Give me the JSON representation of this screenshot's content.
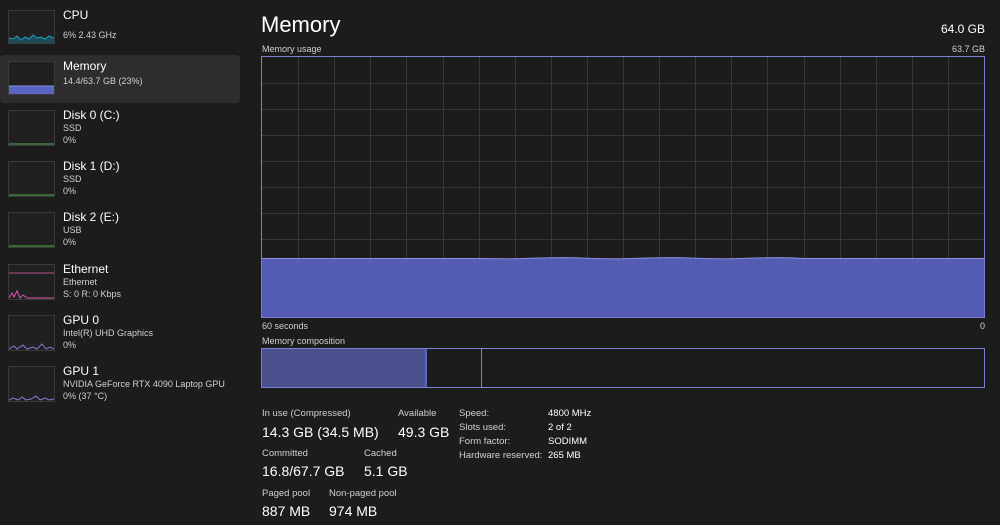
{
  "colors": {
    "background": "#1c1c1c",
    "selected": "#2d2d2d",
    "memory_accent": "#7a80d6",
    "memory_fill": "#5b63c4",
    "cpu_accent": "#1ba1c4",
    "network_accent": "#d75aa6",
    "gpu_accent": "#8a7ad6"
  },
  "sidebar": {
    "items": [
      {
        "name": "CPU",
        "lines": [
          "6%  2.43 GHz"
        ]
      },
      {
        "name": "Memory",
        "lines": [
          "14.4/63.7 GB (23%)"
        ]
      },
      {
        "name": "Disk 0 (C:)",
        "lines": [
          "SSD",
          "0%"
        ]
      },
      {
        "name": "Disk 1 (D:)",
        "lines": [
          "SSD",
          "0%"
        ]
      },
      {
        "name": "Disk 2 (E:)",
        "lines": [
          "USB",
          "0%"
        ]
      },
      {
        "name": "Ethernet",
        "lines": [
          "Ethernet",
          "S: 0  R: 0 Kbps"
        ]
      },
      {
        "name": "GPU 0",
        "lines": [
          "Intel(R) UHD Graphics",
          "0%"
        ]
      },
      {
        "name": "GPU 1",
        "lines": [
          "NVIDIA GeForce RTX 4090 Laptop GPU",
          "0%  (37 °C)"
        ]
      }
    ]
  },
  "header": {
    "title": "Memory",
    "total": "64.0 GB"
  },
  "usage_graph": {
    "label": "Memory usage",
    "max_label": "63.7 GB",
    "time_left": "60 seconds",
    "time_right": "0",
    "fill_fraction": 0.225
  },
  "composition": {
    "label": "Memory composition",
    "in_use_fraction": 0.225,
    "modified_fraction": 0.004,
    "standby_fraction": 0.076
  },
  "stats": {
    "in_use": {
      "label": "In use (Compressed)",
      "value": "14.3 GB (34.5 MB)"
    },
    "available": {
      "label": "Available",
      "value": "49.3 GB"
    },
    "committed": {
      "label": "Committed",
      "value": "16.8/67.7 GB"
    },
    "cached": {
      "label": "Cached",
      "value": "5.1 GB"
    },
    "paged_pool": {
      "label": "Paged pool",
      "value": "887 MB"
    },
    "non_paged_pool": {
      "label": "Non-paged pool",
      "value": "974 MB"
    }
  },
  "details": [
    {
      "label": "Speed:",
      "value": "4800 MHz"
    },
    {
      "label": "Slots used:",
      "value": "2 of 2"
    },
    {
      "label": "Form factor:",
      "value": "SODIMM"
    },
    {
      "label": "Hardware reserved:",
      "value": "265 MB"
    }
  ]
}
